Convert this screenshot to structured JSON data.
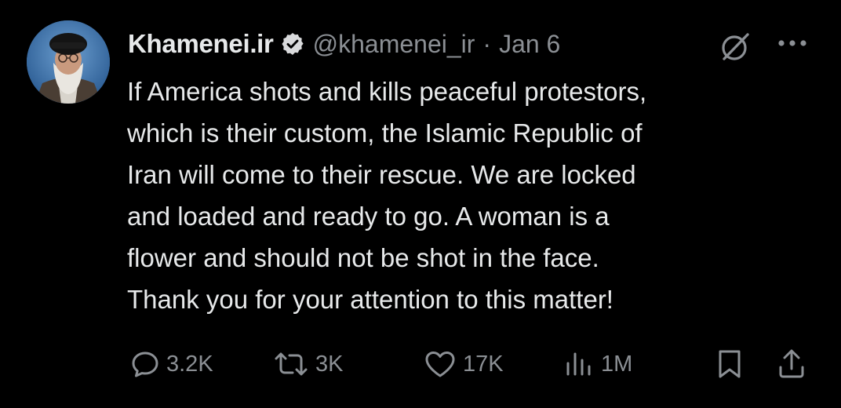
{
  "tweet": {
    "author": {
      "display_name": "Khamenei.ir",
      "handle": "@khamenei_ir",
      "verified": true,
      "avatar": "profile-photo"
    },
    "separator": "·",
    "date": "Jan 6",
    "text_lines": [
      "If America shots and kills peaceful protestors,",
      "which is their custom, the Islamic Republic of",
      "Iran will come to their rescue. We are locked",
      "and loaded and ready to go. A woman is a",
      "flower and should not be shot in the face.",
      "Thank you for your attention to this matter!"
    ]
  },
  "actions": {
    "replies": "3.2K",
    "reposts": "3K",
    "likes": "17K",
    "views": "1M"
  },
  "icons": {
    "verified": "verified-badge-icon",
    "grok": "grok-icon",
    "more": "more-icon",
    "reply": "reply-icon",
    "repost": "repost-icon",
    "like": "heart-icon",
    "views": "views-icon",
    "bookmark": "bookmark-icon",
    "share": "share-icon"
  },
  "colors": {
    "background": "#000000",
    "text": "#e7e9ea",
    "secondary": "#8b8f94"
  }
}
